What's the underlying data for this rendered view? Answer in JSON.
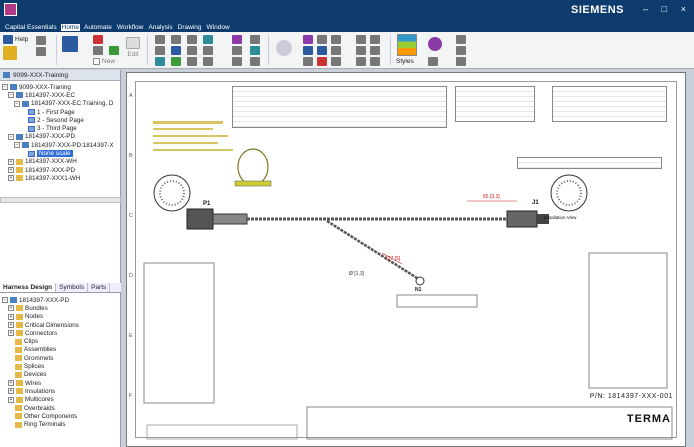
{
  "window": {
    "brand": "SIEMENS",
    "controls": [
      "–",
      "□",
      "×"
    ]
  },
  "menu": [
    "Capital Essentials",
    "Home",
    "Automate",
    "Workflow",
    "Analysis",
    "Drawing",
    "Window"
  ],
  "menu_active": "Home",
  "ribbon": {
    "help_label": "Help",
    "new_label": "New",
    "edit_label": "Edit",
    "styles_label": "Styles"
  },
  "tree": {
    "header": "9099-XXX-Training",
    "items": [
      {
        "label": "9099-XXX-Traning",
        "level": 0,
        "icon": "doc"
      },
      {
        "label": "1814397-XXX-EC",
        "level": 1,
        "icon": "doc"
      },
      {
        "label": "1814397-XXX-EC:Training, D",
        "level": 2,
        "icon": "doc"
      },
      {
        "label": "1 - First Page",
        "level": 3,
        "icon": "page"
      },
      {
        "label": "2 - Sesond Page",
        "level": 3,
        "icon": "page"
      },
      {
        "label": "3 - Third Page",
        "level": 3,
        "icon": "page"
      },
      {
        "label": "1814397-XXX-PD",
        "level": 1,
        "icon": "doc"
      },
      {
        "label": "1814397-XXX-PD:1814397-X",
        "level": 2,
        "icon": "doc"
      },
      {
        "label": "None scale",
        "level": 3,
        "icon": "page",
        "selected": true
      },
      {
        "label": "1814397-XXX-WH",
        "level": 1,
        "icon": "doc"
      },
      {
        "label": "1814397-XXX-PD",
        "level": 1,
        "icon": "doc"
      },
      {
        "label": "1814397-XXX1-WH",
        "level": 1,
        "icon": "doc"
      }
    ]
  },
  "tabs": [
    "Harness Design",
    "Symbols",
    "Parts"
  ],
  "tabs_active": "Harness Design",
  "design_tree": {
    "root": "1814397-XXX-PD",
    "items": [
      "Bundles",
      "Nodes",
      "Critical Dimensions",
      "Connectors",
      "Clips",
      "Assemblies",
      "Grommets",
      "Splices",
      "Devices",
      "Wires",
      "Insulations",
      "Multicores",
      "Overbraids",
      "Other Components",
      "Ring Terminals"
    ]
  },
  "drawing": {
    "p1": "P1",
    "j1": "J1",
    "n1": "N1",
    "install_view": "Installation View",
    "part_number": "P/N: 1814397-XXX-001",
    "logo": "TERMA",
    "dim_top": "85 [3.3]",
    "dim_branch": "127 [5]",
    "dim_b": "Ø [1,3]"
  },
  "colors": {
    "title_bar": "#0e3b6e",
    "accent": "#2f6fd6",
    "folder": "#e5b84a"
  }
}
